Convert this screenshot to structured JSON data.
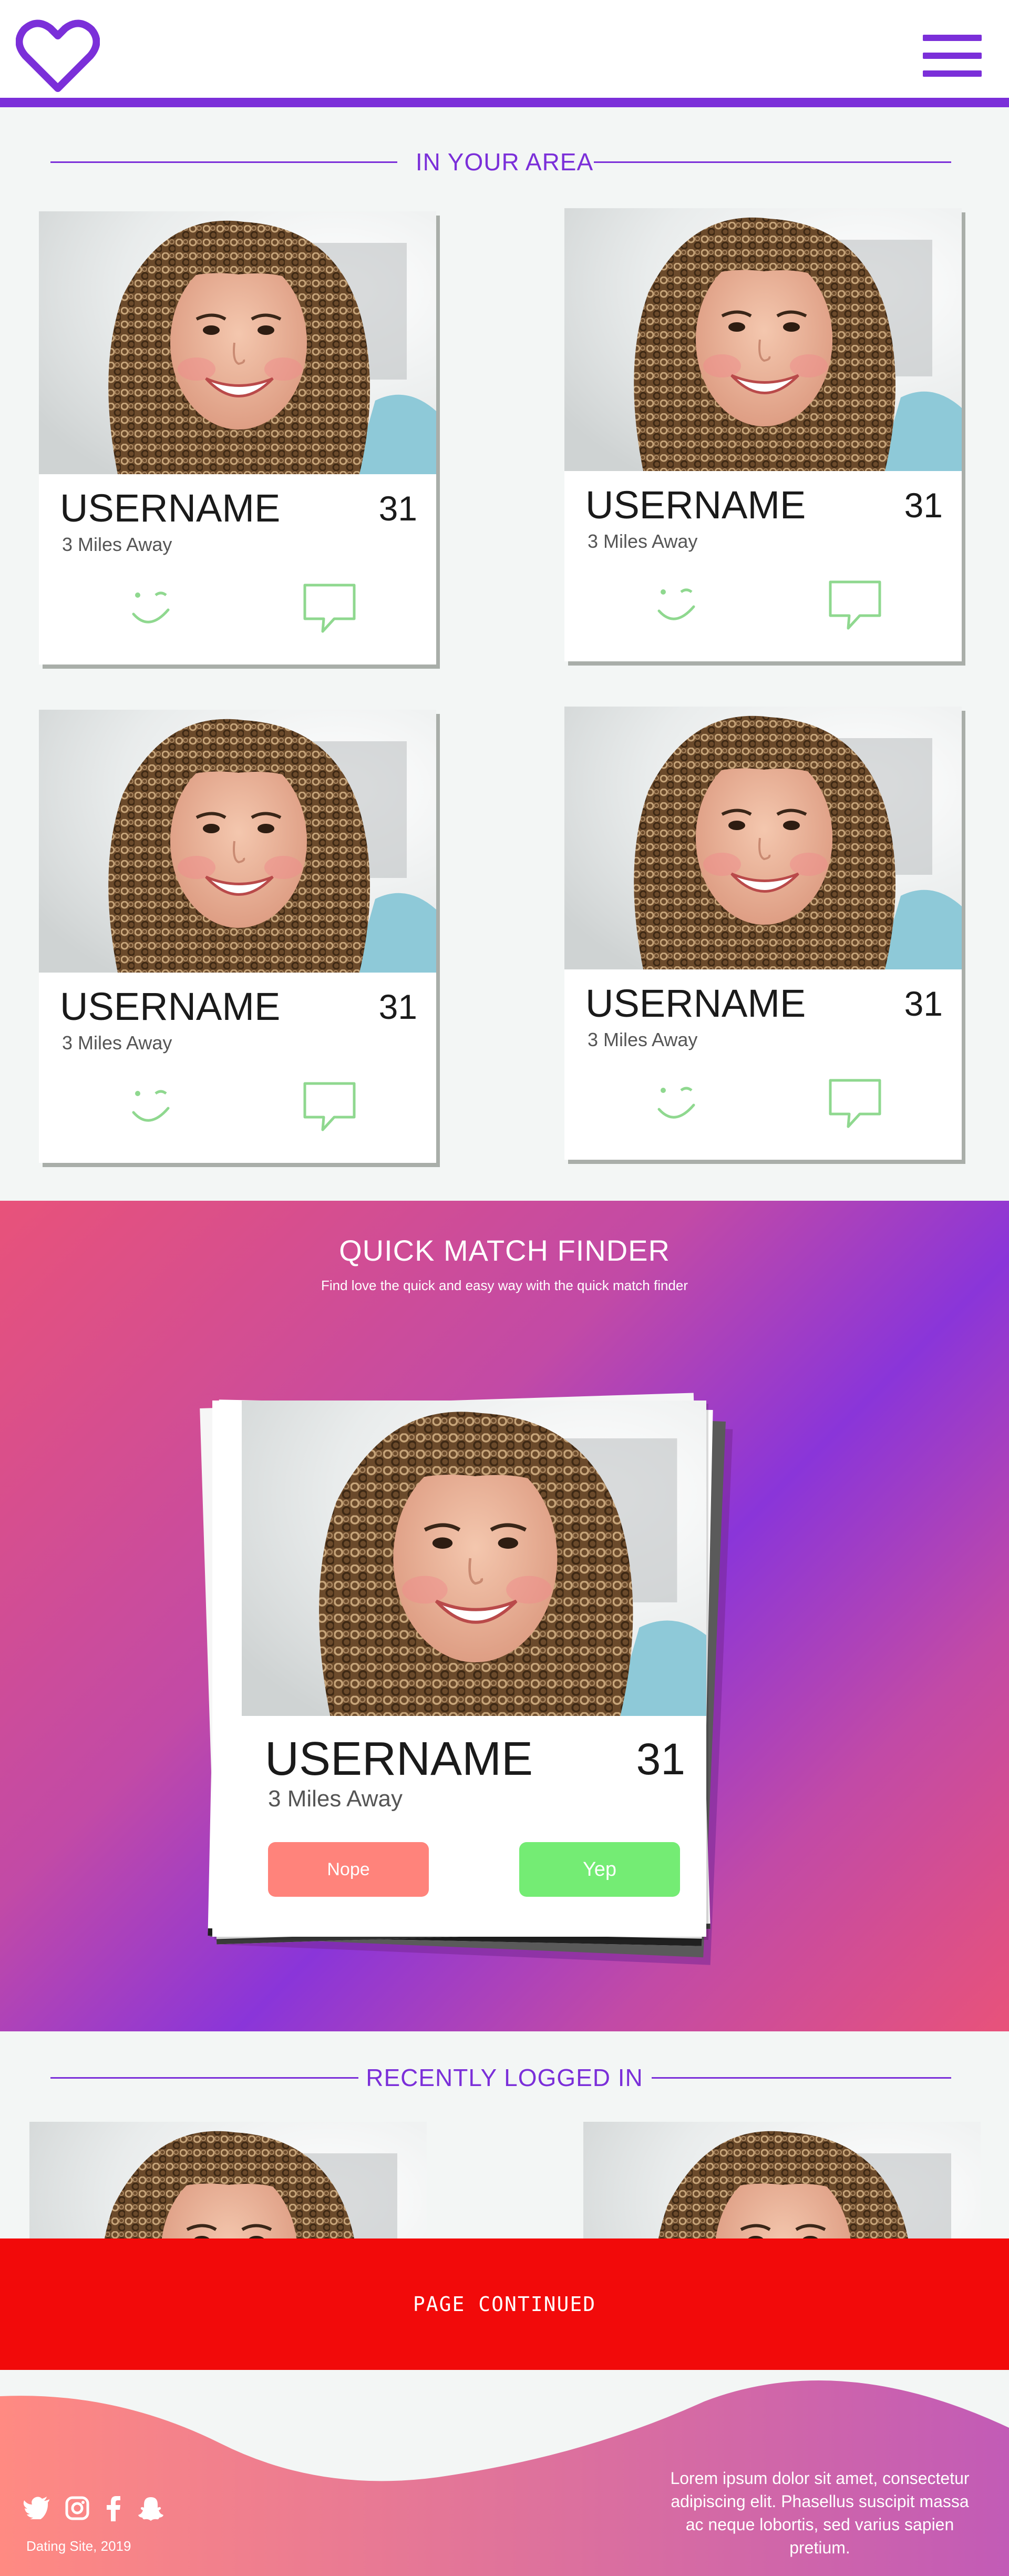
{
  "header": {
    "logo_icon": "heart-outline-icon",
    "menu_icon": "hamburger-menu-icon",
    "accent_color": "#7b2fd9"
  },
  "in_your_area": {
    "title": "IN YOUR AREA",
    "cards": [
      {
        "username": "USERNAME",
        "age": "31",
        "distance": "3 Miles Away"
      },
      {
        "username": "USERNAME",
        "age": "31",
        "distance": "3 Miles Away"
      },
      {
        "username": "USERNAME",
        "age": "31",
        "distance": "3 Miles Away"
      },
      {
        "username": "USERNAME",
        "age": "31",
        "distance": "3 Miles Away"
      }
    ],
    "wink_icon": "wink-face-icon",
    "chat_icon": "chat-bubble-icon",
    "icon_color": "#8fd88f"
  },
  "quick_match": {
    "title": "QUICK MATCH FINDER",
    "subtitle": "Find love the quick and easy way with the quick match finder",
    "card": {
      "username": "USERNAME",
      "age": "31",
      "distance": "3 Miles Away"
    },
    "nope_label": "Nope",
    "yep_label": "Yep",
    "nope_color": "#ff837b",
    "yep_color": "#74ec74"
  },
  "recently_logged_in": {
    "title": "RECENTLY LOGGED IN"
  },
  "banner": {
    "text": "PAGE CONTINUED",
    "color": "#f20a0a"
  },
  "footer": {
    "social_icons": [
      "twitter-icon",
      "instagram-icon",
      "facebook-icon",
      "snapchat-icon"
    ],
    "copyright": "Dating Site, 2019",
    "text": "Lorem ipsum dolor sit amet, consectetur adipiscing elit. Phasellus suscipit massa ac neque lobortis, sed varius sapien pretium."
  }
}
